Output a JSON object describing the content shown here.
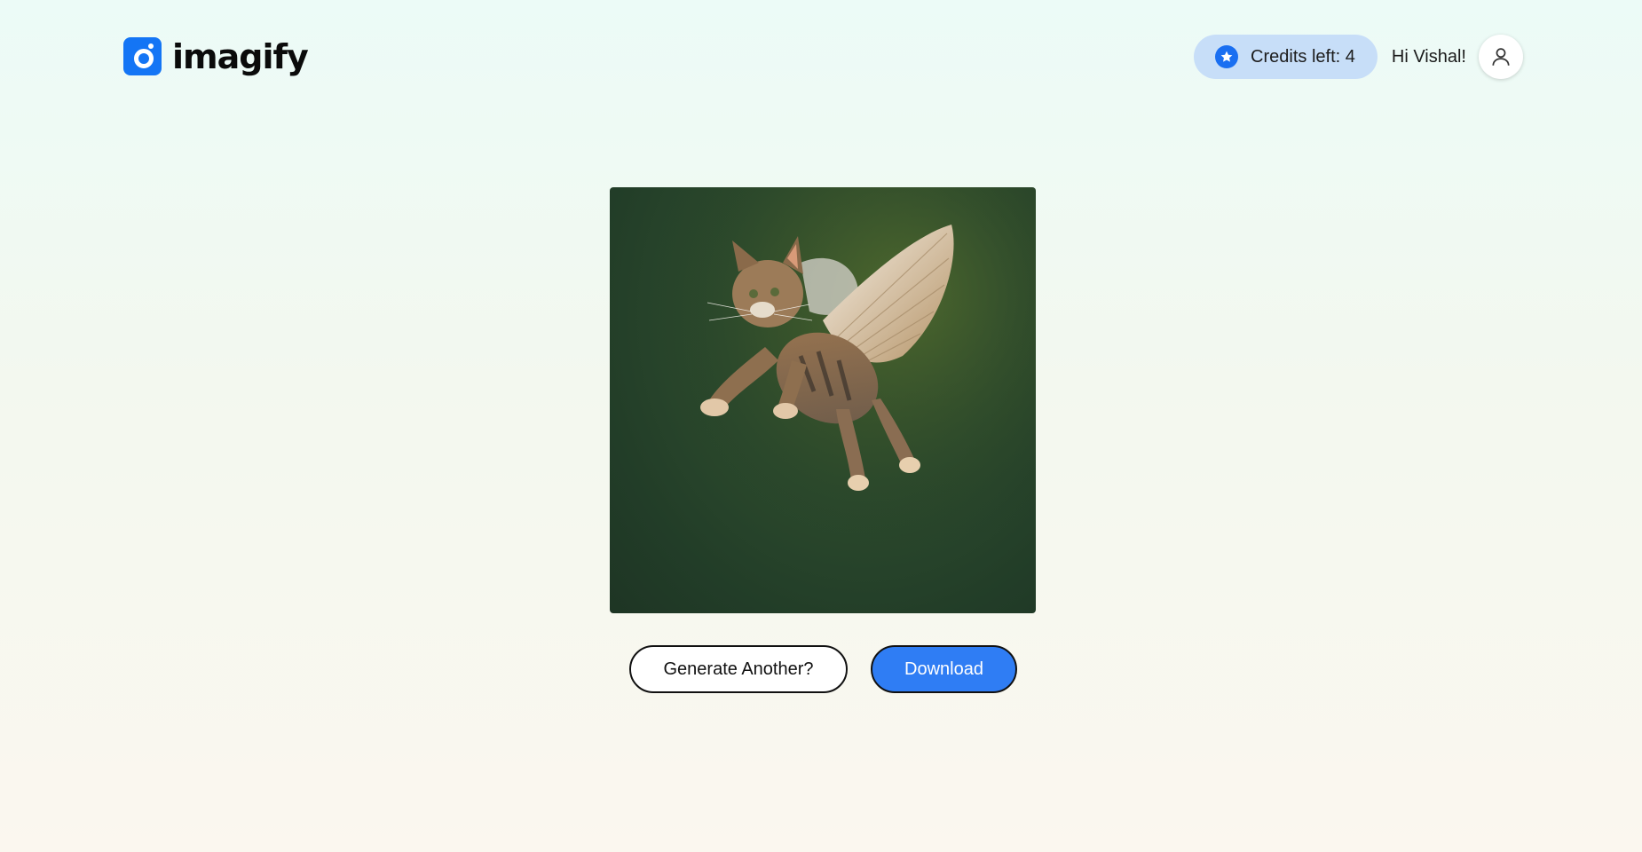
{
  "brand": {
    "name": "imagify",
    "accent_color": "#1475f5"
  },
  "header": {
    "credits_label": "Credits left: 4",
    "greeting": "Hi Vishal!"
  },
  "result": {
    "image_icon": "generated-image"
  },
  "actions": {
    "generate_another_label": "Generate Another?",
    "download_label": "Download"
  }
}
